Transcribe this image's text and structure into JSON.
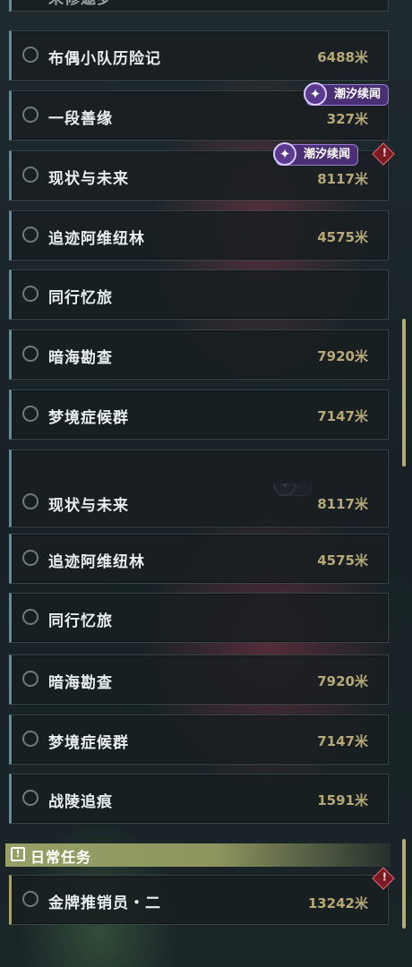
{
  "panel_a": {
    "partial_top_title": "未修邀罗",
    "items": [
      {
        "title": "布偶小队历险记",
        "distance": "6488米"
      },
      {
        "title": "一段善缘",
        "distance": "327米",
        "badge": "潮汐续闻"
      },
      {
        "title": "现状与未来",
        "distance": "8117米",
        "badge": "潮汐续闻",
        "alert": "!"
      },
      {
        "title": "追迹阿维纽林",
        "distance": "4575米"
      },
      {
        "title": "同行忆旅",
        "distance": ""
      },
      {
        "title": "暗海勘查",
        "distance": "7920米"
      },
      {
        "title": "梦境症候群",
        "distance": "7147米"
      }
    ]
  },
  "panel_b": {
    "items": [
      {
        "title": "现状与未来",
        "distance": "8117米"
      },
      {
        "title": "追迹阿维纽林",
        "distance": "4575米"
      },
      {
        "title": "同行忆旅",
        "distance": ""
      },
      {
        "title": "暗海勘查",
        "distance": "7920米"
      },
      {
        "title": "梦境症候群",
        "distance": "7147米"
      },
      {
        "title": "战陵追痕",
        "distance": "1591米"
      }
    ],
    "section": {
      "icon": "!",
      "title": "日常任务"
    },
    "daily": {
      "title": "金牌推销员・二",
      "distance": "13242米",
      "alert": "!"
    }
  },
  "icons": {
    "badge": "sparkle-star-icon",
    "alert": "warning-diamond-icon",
    "section": "exclamation-box-icon"
  },
  "colors": {
    "distance": "#b8a878",
    "badge_bg": "#4a2f74",
    "section_bar": "#96a067",
    "alert": "#7a1a22"
  }
}
